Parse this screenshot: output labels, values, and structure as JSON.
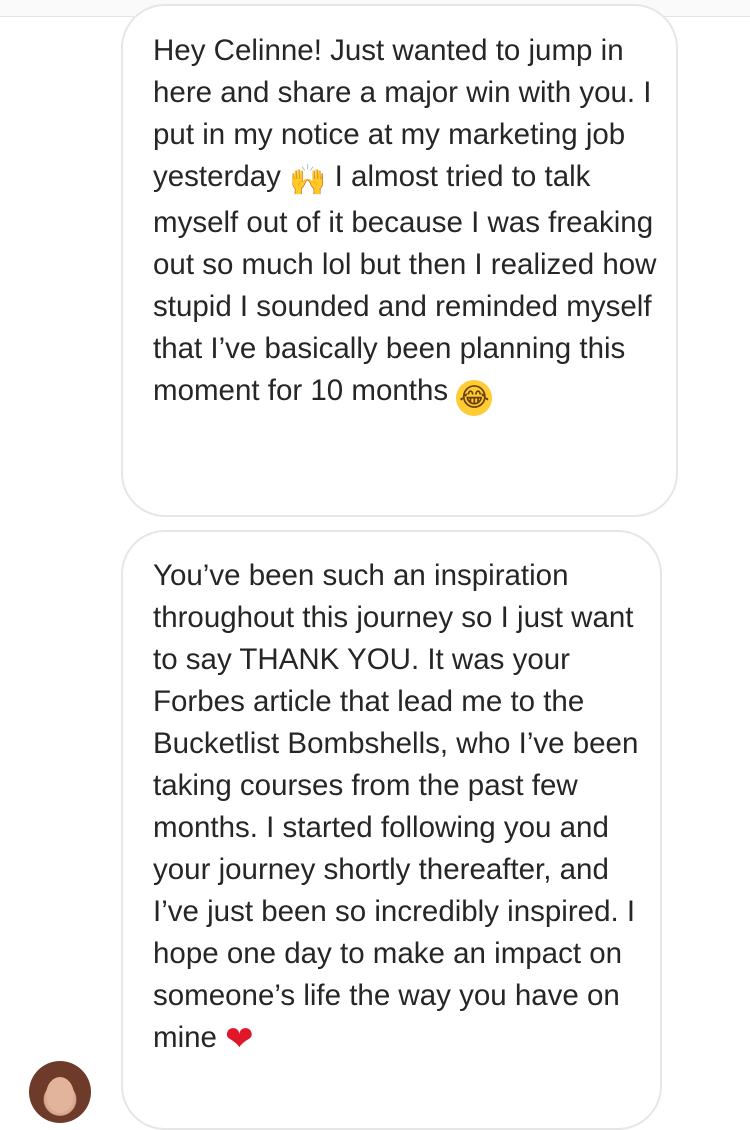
{
  "conversation": {
    "messages": [
      {
        "sender": "other",
        "text_before_hands": "Hey Celinne! Just wanted to jump in here and share a major win with you. I put in my notice at my marketing job yesterday ",
        "hands_emoji": "🙌",
        "text_after_hands": " I almost tried to talk myself out of it because I was freaking out so much lol but then I realized how stupid I sounded and reminded myself that I’ve basically been planning this moment for 10 months ",
        "laugh_emoji": "😂"
      },
      {
        "sender": "other",
        "text": "You’ve been such an inspiration throughout this journey so I just want to say THANK YOU. It was your Forbes article that lead me to the Bucketlist Bombshells, who I’ve been taking courses from the past few months. I started following you and your journey shortly thereafter, and I’ve just been so incredibly inspired. I hope one day to make an impact on someone’s life the way you have on mine ",
        "heart_emoji": "❤"
      }
    ]
  },
  "colors": {
    "bubble_border": "#e6e6e6",
    "text": "#262626",
    "heart": "#e0162b"
  }
}
